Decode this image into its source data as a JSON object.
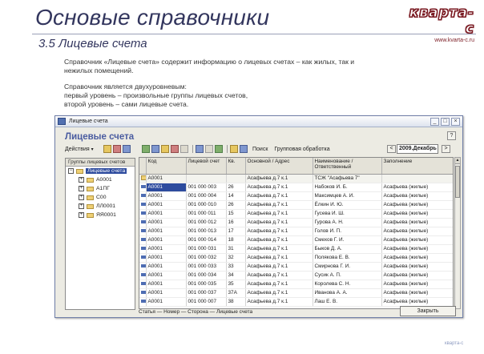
{
  "slide": {
    "title": "Основые справочники",
    "subtitle": "3.5  Лицевые счета",
    "logo": "кварта-с",
    "logo_site": "www.kvarta-c.ru",
    "para1": "Справочник «Лицевые счета» содержит информацию о лицевых счетах – как жилых, так и нежилых помещений.",
    "para2_l1": "Справочник является двухуровневым:",
    "para2_l2": "первый уровень – произвольные группы лицевых счетов,",
    "para2_l3": "второй уровень – сами лицевые счета.",
    "footer_mark": "кварта-с"
  },
  "window": {
    "title": "Лицевые счета",
    "form_title": "Лицевые счета",
    "actions_label": "Действия",
    "search_label": "Поиск",
    "group_label": "Групповая обработка",
    "period": "2009.Декабрь",
    "help": "?",
    "close_btn": "Закрыть",
    "minimize": "_",
    "maximize": "□",
    "close": "×",
    "prev": "<",
    "next": ">"
  },
  "tree": {
    "header": "Группы лицевых счетов",
    "items": [
      {
        "label": "Лицевые счета",
        "level": 0,
        "selected": true
      },
      {
        "label": "А0001",
        "level": 1,
        "selected": false
      },
      {
        "label": "А1ПГ",
        "level": 1,
        "selected": false
      },
      {
        "label": "С00",
        "level": 1,
        "selected": false
      },
      {
        "label": "ЛЛ0001",
        "level": 1,
        "selected": false
      },
      {
        "label": "ЯЯ0001",
        "level": 1,
        "selected": false
      }
    ]
  },
  "grid": {
    "columns": [
      "Код",
      "Лицевой счет",
      "Кв.",
      "Основной / Адрес",
      "Наименование / Ответственный",
      "Заполнение"
    ],
    "rows": [
      [
        "А0001",
        "",
        "",
        "Асафьева д.7 к.1",
        "ТСЖ \"Асафьева 7\"",
        ""
      ],
      [
        "А0001",
        "001 000 003",
        "26",
        "Асафьева д.7 к.1",
        "Набоков И. Б.",
        "Асафьева (жилые)"
      ],
      [
        "А0001",
        "001 000 004",
        "14",
        "Асафьева д.7 к.1",
        "Максимцев А. И.",
        "Асафьева (жилые)"
      ],
      [
        "А0001",
        "001 000 010",
        "26",
        "Асафьева д.7 к.1",
        "Ёлкин И. Ю.",
        "Асафьева (жилые)"
      ],
      [
        "А0001",
        "001 000 011",
        "15",
        "Асафьева д.7 к.1",
        "Гусева И. Ш.",
        "Асафьева (жилые)"
      ],
      [
        "А0001",
        "001 000 012",
        "16",
        "Асафьева д.7 к.1",
        "Гурова А. Н.",
        "Асафьева (жилые)"
      ],
      [
        "А0001",
        "001 000 013",
        "17",
        "Асафьева д.7 к.1",
        "Голов И. П.",
        "Асафьева (жилые)"
      ],
      [
        "А0001",
        "001 000 014",
        "18",
        "Асафьева д.7 к.1",
        "Смехов Г. И.",
        "Асафьева (жилые)"
      ],
      [
        "А0001",
        "001 000 031",
        "31",
        "Асафьева д.7 к.1",
        "Быков Д. А.",
        "Асафьева (жилые)"
      ],
      [
        "А0001",
        "001 000 032",
        "32",
        "Асафьева д.7 к.1",
        "Полякова Е. В.",
        "Асафьева (жилые)"
      ],
      [
        "А0001",
        "001 000 033",
        "33",
        "Асафьева д.7 к.1",
        "Смирнова Г. И.",
        "Асафьева (жилые)"
      ],
      [
        "А0001",
        "001 000 034",
        "34",
        "Асафьева д.7 к.1",
        "Сусик А. П.",
        "Асафьева (жилые)"
      ],
      [
        "А0001",
        "001 000 035",
        "35",
        "Асафьева д.7 к.1",
        "Королева С. Н.",
        "Асафьева (жилые)"
      ],
      [
        "А0001",
        "001 000 037",
        "37А",
        "Асафьева д.7 к.1",
        "Иванова А. А.",
        "Асафьева (жилые)"
      ],
      [
        "А0001",
        "001 000 007",
        "38",
        "Асафьева д.7 к.1",
        "Лаш Е. В.",
        "Асафьева (жилые)"
      ]
    ]
  },
  "bottom": {
    "text": "Статья — Номер — Сторона — Лицевые счета"
  },
  "colors": {
    "accent": "#4a5ca0",
    "selection": "#2d4b9e",
    "title": "#33365e"
  }
}
